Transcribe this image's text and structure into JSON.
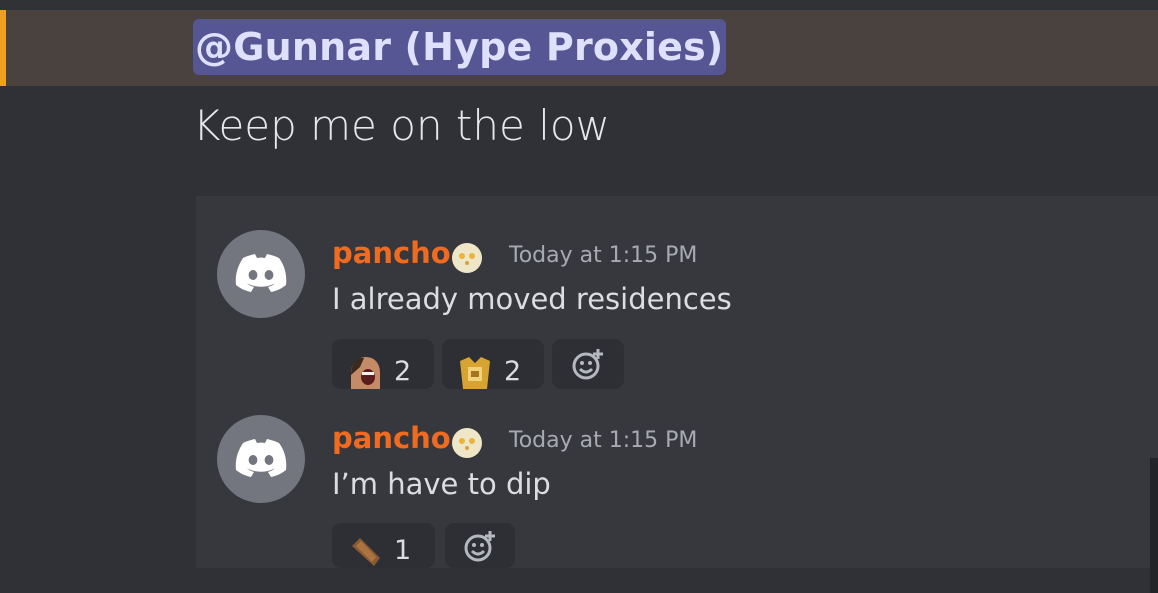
{
  "mention": "@Gunnar (Hype Proxies)",
  "quote_text": "Keep me on the low",
  "messages": [
    {
      "username": "pancho",
      "timestamp": "Today at 1:15 PM",
      "text": "I already moved residences",
      "reactions": [
        {
          "emoji": "laughing-face-emoji",
          "count": "2"
        },
        {
          "emoji": "golden-statue-emoji",
          "count": "2"
        }
      ]
    },
    {
      "username": "pancho",
      "timestamp": "Today at 1:15 PM",
      "text": "I’m have to dip",
      "reactions": [
        {
          "emoji": "coffin-emoji",
          "count": "1"
        }
      ]
    }
  ],
  "colors": {
    "username": "#f06a1f",
    "mention_accent": "#f0a020",
    "mention_pill": "#565694",
    "avatar_bg": "#73767f"
  }
}
